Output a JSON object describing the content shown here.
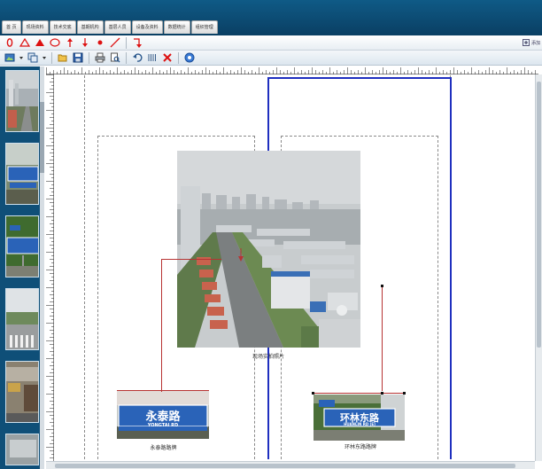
{
  "header": {
    "tabs": [
      "首 页",
      "现场资料",
      "技术交底",
      "基期机构",
      "基层人员",
      "设备及资料",
      "数据统计",
      "组织管理"
    ]
  },
  "toolbar": {
    "row1_icons": [
      "number-zero-icon",
      "triangle-outline-icon",
      "triangle-filled-icon",
      "ellipse-icon",
      "arrow-up-icon",
      "arrow-down-icon",
      "dot-icon",
      "line-icon",
      "corner-arrow-icon"
    ],
    "row2_icons": [
      "image-icon",
      "duplicate-icon",
      "folder-open-icon",
      "save-icon",
      "print-icon",
      "print-preview-icon",
      "undo-icon",
      "grid-icon",
      "delete-icon",
      "help-icon"
    ],
    "right_label": "添加"
  },
  "canvas": {
    "main_photo_caption": "现场实拍照片",
    "left_sign_caption": "永泰路路牌",
    "right_sign_caption": "环林东路路牌",
    "left_sign": {
      "cn": "永泰路",
      "en": "YONGTAI RD"
    },
    "right_sign": {
      "cn": "环林东路",
      "en": "HUANLIN RD (E)"
    }
  },
  "colors": {
    "header": "#0f5a86",
    "sidebar": "#0f4f78",
    "guide_blue": "#1f2fbf",
    "leader_red": "#b73333",
    "sign_blue": "#2a63b8"
  }
}
